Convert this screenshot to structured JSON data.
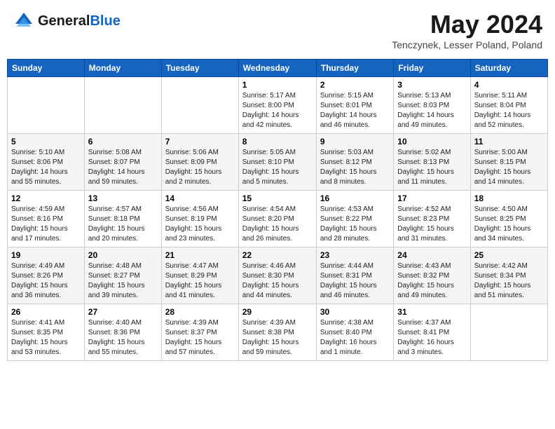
{
  "header": {
    "logo_general": "General",
    "logo_blue": "Blue",
    "month_title": "May 2024",
    "location": "Tenczynek, Lesser Poland, Poland"
  },
  "weekdays": [
    "Sunday",
    "Monday",
    "Tuesday",
    "Wednesday",
    "Thursday",
    "Friday",
    "Saturday"
  ],
  "weeks": [
    [
      {
        "day": "",
        "info": ""
      },
      {
        "day": "",
        "info": ""
      },
      {
        "day": "",
        "info": ""
      },
      {
        "day": "1",
        "info": "Sunrise: 5:17 AM\nSunset: 8:00 PM\nDaylight: 14 hours\nand 42 minutes."
      },
      {
        "day": "2",
        "info": "Sunrise: 5:15 AM\nSunset: 8:01 PM\nDaylight: 14 hours\nand 46 minutes."
      },
      {
        "day": "3",
        "info": "Sunrise: 5:13 AM\nSunset: 8:03 PM\nDaylight: 14 hours\nand 49 minutes."
      },
      {
        "day": "4",
        "info": "Sunrise: 5:11 AM\nSunset: 8:04 PM\nDaylight: 14 hours\nand 52 minutes."
      }
    ],
    [
      {
        "day": "5",
        "info": "Sunrise: 5:10 AM\nSunset: 8:06 PM\nDaylight: 14 hours\nand 55 minutes."
      },
      {
        "day": "6",
        "info": "Sunrise: 5:08 AM\nSunset: 8:07 PM\nDaylight: 14 hours\nand 59 minutes."
      },
      {
        "day": "7",
        "info": "Sunrise: 5:06 AM\nSunset: 8:09 PM\nDaylight: 15 hours\nand 2 minutes."
      },
      {
        "day": "8",
        "info": "Sunrise: 5:05 AM\nSunset: 8:10 PM\nDaylight: 15 hours\nand 5 minutes."
      },
      {
        "day": "9",
        "info": "Sunrise: 5:03 AM\nSunset: 8:12 PM\nDaylight: 15 hours\nand 8 minutes."
      },
      {
        "day": "10",
        "info": "Sunrise: 5:02 AM\nSunset: 8:13 PM\nDaylight: 15 hours\nand 11 minutes."
      },
      {
        "day": "11",
        "info": "Sunrise: 5:00 AM\nSunset: 8:15 PM\nDaylight: 15 hours\nand 14 minutes."
      }
    ],
    [
      {
        "day": "12",
        "info": "Sunrise: 4:59 AM\nSunset: 8:16 PM\nDaylight: 15 hours\nand 17 minutes."
      },
      {
        "day": "13",
        "info": "Sunrise: 4:57 AM\nSunset: 8:18 PM\nDaylight: 15 hours\nand 20 minutes."
      },
      {
        "day": "14",
        "info": "Sunrise: 4:56 AM\nSunset: 8:19 PM\nDaylight: 15 hours\nand 23 minutes."
      },
      {
        "day": "15",
        "info": "Sunrise: 4:54 AM\nSunset: 8:20 PM\nDaylight: 15 hours\nand 26 minutes."
      },
      {
        "day": "16",
        "info": "Sunrise: 4:53 AM\nSunset: 8:22 PM\nDaylight: 15 hours\nand 28 minutes."
      },
      {
        "day": "17",
        "info": "Sunrise: 4:52 AM\nSunset: 8:23 PM\nDaylight: 15 hours\nand 31 minutes."
      },
      {
        "day": "18",
        "info": "Sunrise: 4:50 AM\nSunset: 8:25 PM\nDaylight: 15 hours\nand 34 minutes."
      }
    ],
    [
      {
        "day": "19",
        "info": "Sunrise: 4:49 AM\nSunset: 8:26 PM\nDaylight: 15 hours\nand 36 minutes."
      },
      {
        "day": "20",
        "info": "Sunrise: 4:48 AM\nSunset: 8:27 PM\nDaylight: 15 hours\nand 39 minutes."
      },
      {
        "day": "21",
        "info": "Sunrise: 4:47 AM\nSunset: 8:29 PM\nDaylight: 15 hours\nand 41 minutes."
      },
      {
        "day": "22",
        "info": "Sunrise: 4:46 AM\nSunset: 8:30 PM\nDaylight: 15 hours\nand 44 minutes."
      },
      {
        "day": "23",
        "info": "Sunrise: 4:44 AM\nSunset: 8:31 PM\nDaylight: 15 hours\nand 46 minutes."
      },
      {
        "day": "24",
        "info": "Sunrise: 4:43 AM\nSunset: 8:32 PM\nDaylight: 15 hours\nand 49 minutes."
      },
      {
        "day": "25",
        "info": "Sunrise: 4:42 AM\nSunset: 8:34 PM\nDaylight: 15 hours\nand 51 minutes."
      }
    ],
    [
      {
        "day": "26",
        "info": "Sunrise: 4:41 AM\nSunset: 8:35 PM\nDaylight: 15 hours\nand 53 minutes."
      },
      {
        "day": "27",
        "info": "Sunrise: 4:40 AM\nSunset: 8:36 PM\nDaylight: 15 hours\nand 55 minutes."
      },
      {
        "day": "28",
        "info": "Sunrise: 4:39 AM\nSunset: 8:37 PM\nDaylight: 15 hours\nand 57 minutes."
      },
      {
        "day": "29",
        "info": "Sunrise: 4:39 AM\nSunset: 8:38 PM\nDaylight: 15 hours\nand 59 minutes."
      },
      {
        "day": "30",
        "info": "Sunrise: 4:38 AM\nSunset: 8:40 PM\nDaylight: 16 hours\nand 1 minute."
      },
      {
        "day": "31",
        "info": "Sunrise: 4:37 AM\nSunset: 8:41 PM\nDaylight: 16 hours\nand 3 minutes."
      },
      {
        "day": "",
        "info": ""
      }
    ]
  ]
}
